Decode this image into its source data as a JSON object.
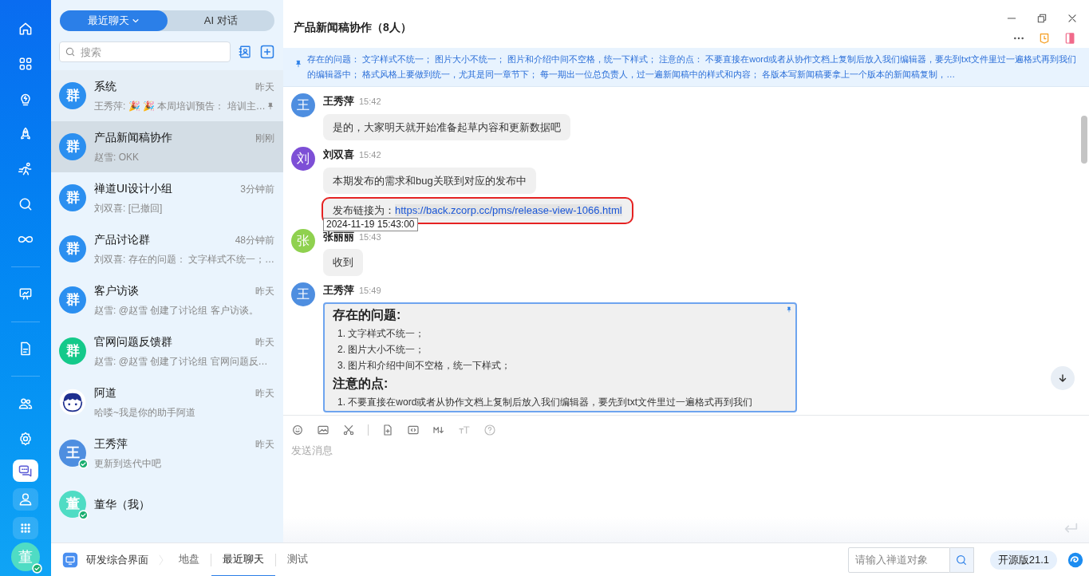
{
  "rail": {
    "groups": [
      {
        "items": [
          {
            "kind": "home",
            "selected": false
          },
          {
            "kind": "grid",
            "selected": false
          },
          {
            "kind": "bulb",
            "selected": false
          },
          {
            "kind": "rocket",
            "selected": false
          },
          {
            "kind": "runner",
            "selected": false
          },
          {
            "kind": "search",
            "selected": false
          },
          {
            "kind": "infinity",
            "selected": false
          }
        ]
      },
      {
        "items": [
          {
            "kind": "board",
            "selected": false
          }
        ]
      },
      {
        "items": [
          {
            "kind": "doc",
            "selected": false
          }
        ]
      },
      {
        "items": [
          {
            "kind": "people",
            "selected": false
          },
          {
            "kind": "gear",
            "selected": false
          },
          {
            "kind": "chat",
            "selected": true
          },
          {
            "kind": "user",
            "selected": false
          },
          {
            "kind": "apps",
            "selected": false
          }
        ]
      }
    ],
    "me": {
      "text": "董",
      "online": true
    }
  },
  "list_tabs": [
    {
      "label": "最近聊天",
      "selected": true,
      "dropdown": true
    },
    {
      "label": "AI 对话",
      "selected": false,
      "dropdown": false
    }
  ],
  "search": {
    "placeholder": "搜索"
  },
  "conversations": [
    {
      "name": "系统",
      "time": "昨天",
      "preview": "王秀萍: 🎉 🎉 本周培训预告： 培训主…",
      "avatar": {
        "kind": "text",
        "text": "群",
        "color": "#2b8ff0"
      },
      "selected": false,
      "pinned": true,
      "online": false
    },
    {
      "name": "产品新闻稿协作",
      "time": "刚刚",
      "preview": "赵雪: OKK",
      "avatar": {
        "kind": "text",
        "text": "群",
        "color": "#2b8ff0"
      },
      "selected": true,
      "pinned": false,
      "online": false
    },
    {
      "name": "禅道UI设计小组",
      "time": "3分钟前",
      "preview": "刘双喜: [已撤回]",
      "avatar": {
        "kind": "text",
        "text": "群",
        "color": "#2b8ff0"
      },
      "selected": false,
      "pinned": false,
      "online": false
    },
    {
      "name": "产品讨论群",
      "time": "48分钟前",
      "preview": "刘双喜: 存在的问题： 文字样式不统一；…",
      "avatar": {
        "kind": "text",
        "text": "群",
        "color": "#2b8ff0"
      },
      "selected": false,
      "pinned": false,
      "online": false
    },
    {
      "name": "客户访谈",
      "time": "昨天",
      "preview": "赵雪: @赵雪 创建了讨论组 客户访谈。",
      "avatar": {
        "kind": "text",
        "text": "群",
        "color": "#2b8ff0"
      },
      "selected": false,
      "pinned": false,
      "online": false
    },
    {
      "name": "官网问题反馈群",
      "time": "昨天",
      "preview": "赵雪: @赵雪 创建了讨论组 官网问题反…",
      "avatar": {
        "kind": "text",
        "text": "群",
        "color": "#14c98a"
      },
      "selected": false,
      "pinned": false,
      "online": false
    },
    {
      "name": "阿道",
      "time": "昨天",
      "preview": "哈喽~我是你的助手阿道",
      "avatar": {
        "kind": "bot",
        "color": "#ffffff"
      },
      "selected": false,
      "pinned": false,
      "online": false
    },
    {
      "name": "王秀萍",
      "time": "昨天",
      "preview": "更新到迭代中吧",
      "avatar": {
        "kind": "text",
        "text": "王",
        "color": "#4e8ee0"
      },
      "selected": false,
      "pinned": false,
      "online": true
    },
    {
      "name": "董华（我）",
      "avatar": {
        "kind": "text",
        "text": "董",
        "color": "#4fdcc4"
      },
      "selected": false,
      "pinned": false,
      "online": true
    }
  ],
  "chat": {
    "title": "产品新闻稿协作（8人）",
    "notice": "存在的问题： 文字样式不统一； 图片大小不统一； 图片和介绍中间不空格，统一下样式； 注意的点： 不要直接在word或者从协作文档上复制后放入我们编辑器，要先到txt文件里过一遍格式再到我们的编辑器中； 格式风格上要做到统一，尤其是同一章节下； 每一期出一位总负责人，过一遍新闻稿中的样式和内容； 各版本写新闻稿要拿上一个版本的新闻稿复制，…",
    "messages": [
      {
        "sender": "王秀萍",
        "time": "15:42",
        "avatar": {
          "text": "王",
          "color": "#4e8ee0"
        },
        "blocks": [
          {
            "kind": "text",
            "text": "是的，大家明天就开始准备起草内容和更新数据吧"
          }
        ]
      },
      {
        "sender": "刘双喜",
        "time": "15:42",
        "avatar": {
          "text": "刘",
          "color": "#7d4fd6"
        },
        "blocks": [
          {
            "kind": "text",
            "text": "本期发布的需求和bug关联到对应的发布中"
          },
          {
            "kind": "link",
            "prefix": "发布链接为：",
            "url": "https://back.zcorp.cc/pms/release-view-1066.html",
            "highlighted": true,
            "tooltip": "2024-11-19 15:43:00"
          }
        ]
      },
      {
        "sender": "张丽丽",
        "time": "15:43",
        "avatar": {
          "text": "张",
          "color": "#8fd14f"
        },
        "blocks": [
          {
            "kind": "text",
            "text": "收到"
          }
        ]
      },
      {
        "sender": "王秀萍",
        "time": "15:49",
        "avatar": {
          "text": "王",
          "color": "#4e8ee0"
        },
        "blocks": [
          {
            "kind": "rich",
            "pinned": true,
            "sections": [
              {
                "heading": "存在的问题:",
                "items": [
                  "1. 文字样式不统一；",
                  "2. 图片大小不统一；",
                  "3. 图片和介绍中间不空格，统一下样式；"
                ]
              },
              {
                "heading": "注意的点:",
                "items": [
                  "1. 不要直接在word或者从协作文档上复制后放入我们编辑器，要先到txt文件里过一遍格式再到我们"
                ]
              }
            ]
          }
        ]
      }
    ],
    "composer": {
      "placeholder": "发送消息"
    }
  },
  "bottom_bar": {
    "app": "研发综合界面",
    "crumbs": [
      {
        "label": "地盘",
        "selected": false
      },
      {
        "label": "最近聊天",
        "selected": true
      },
      {
        "label": "测试",
        "selected": false
      }
    ],
    "search_placeholder": "请输入禅道对象",
    "version": "开源版21.1"
  }
}
